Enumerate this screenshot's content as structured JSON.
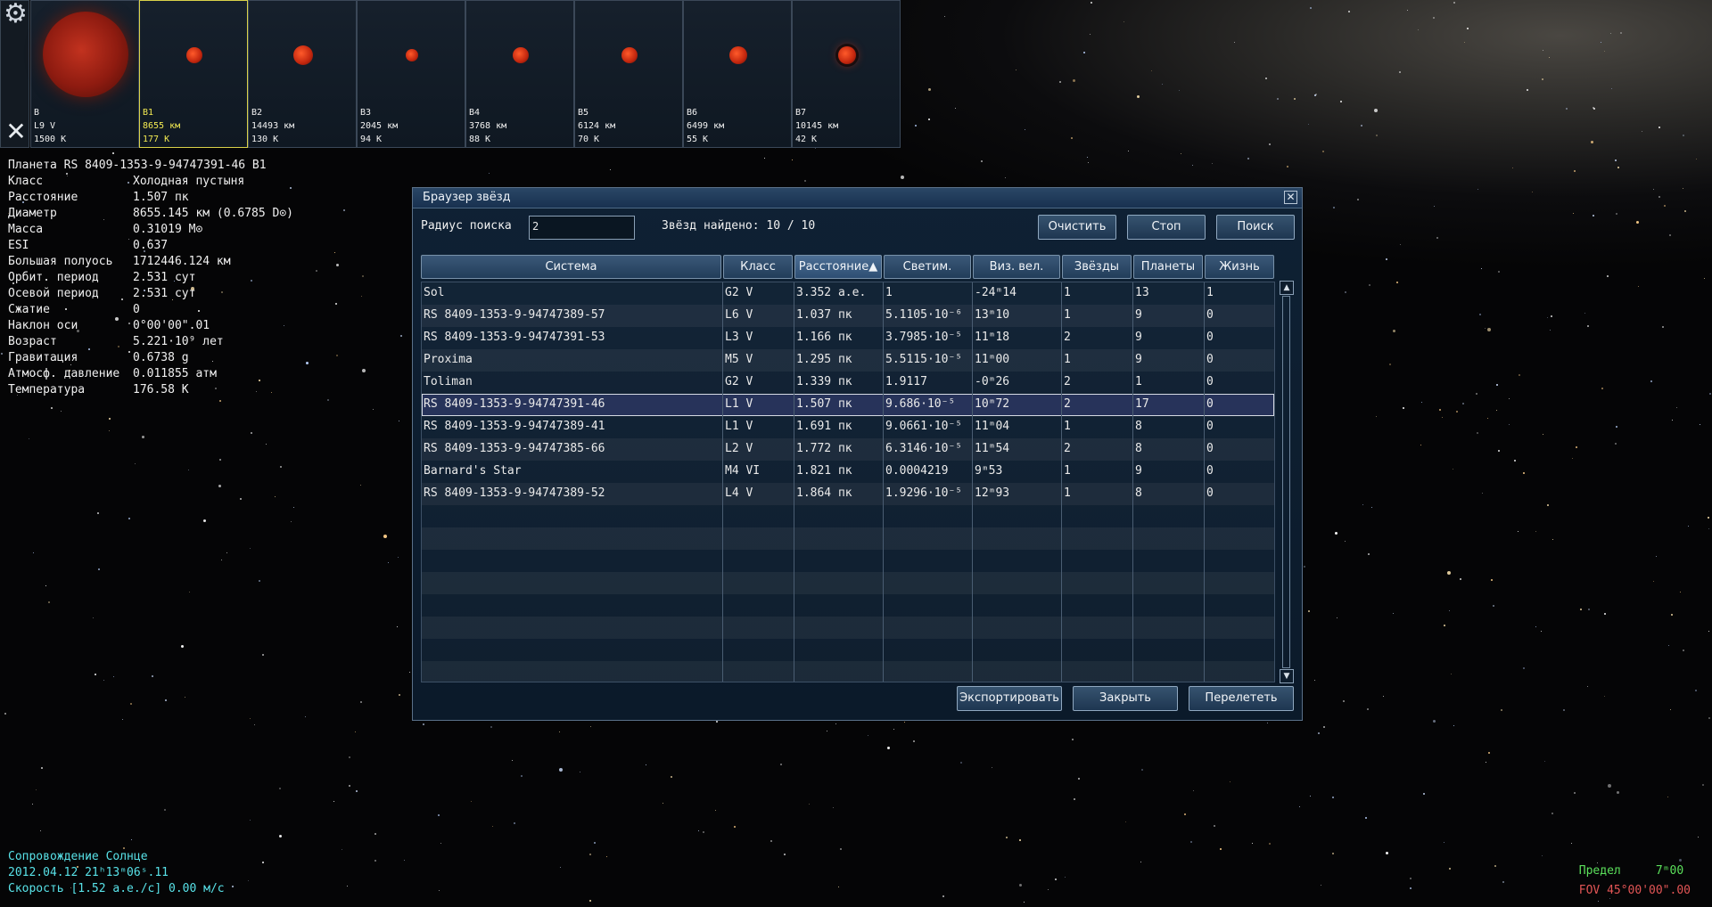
{
  "colors": {
    "accent": "#27335a",
    "status_text": "#58e2e8",
    "limit_text": "#5be05b",
    "fov_text": "#e25555",
    "selected_thumb": "#f3ea52"
  },
  "thumbnails": [
    {
      "name": "B",
      "line2": "L9 V",
      "line3": "1500 K",
      "selected": false
    },
    {
      "name": "B1",
      "line2": "8655 км",
      "line3": "177 K",
      "selected": true
    },
    {
      "name": "B2",
      "line2": "14493 км",
      "line3": "130 K",
      "selected": false
    },
    {
      "name": "B3",
      "line2": "2045 км",
      "line3": "94 K",
      "selected": false
    },
    {
      "name": "B4",
      "line2": "3768 км",
      "line3": "88 K",
      "selected": false
    },
    {
      "name": "B5",
      "line2": "6124 км",
      "line3": "70 K",
      "selected": false
    },
    {
      "name": "B6",
      "line2": "6499 км",
      "line3": "55 K",
      "selected": false
    },
    {
      "name": "B7",
      "line2": "10145 км",
      "line3": "42 K",
      "selected": false
    }
  ],
  "planet_info": {
    "title": "Планета  RS 8409-1353-9-94747391-46 B1",
    "rows": [
      {
        "label": "Класс",
        "value": "Холодная пустыня"
      },
      {
        "label": "Расстояние",
        "value": "1.507 пк"
      },
      {
        "label": "Диаметр",
        "value": "8655.145 км (0.6785 D⊙)"
      },
      {
        "label": "Масса",
        "value": "0.31019 M⊙"
      },
      {
        "label": "ESI",
        "value": "0.637"
      },
      {
        "label": "Большая полуось",
        "value": "1712446.124 км"
      },
      {
        "label": "Орбит. период",
        "value": "2.531 сут"
      },
      {
        "label": "Осевой период",
        "value": "2.531 сут"
      },
      {
        "label": "Сжатие",
        "value": "0"
      },
      {
        "label": "Наклон оси",
        "value": "0°00'00\".01"
      },
      {
        "label": "Возраст",
        "value": "5.221·10⁹ лет"
      },
      {
        "label": "Гравитация",
        "value": "0.6738 g"
      },
      {
        "label": "Атмосф. давление",
        "value": "0.011855 атм"
      },
      {
        "label": "Температура",
        "value": "176.58 K"
      }
    ]
  },
  "dialog": {
    "title": "Браузер звёзд",
    "search_label": "Радиус поиска",
    "search_value": "2",
    "found_text": "Звёзд найдено: 10 / 10",
    "buttons": {
      "clear": "Очистить",
      "stop": "Стоп",
      "search": "Поиск",
      "export": "Экспортировать",
      "close": "Закрыть",
      "goto": "Перелететь"
    },
    "columns": [
      "Система",
      "Класс",
      "Расстояние▲",
      "Светим.",
      "Виз. вел.",
      "Звёзды",
      "Планеты",
      "Жизнь"
    ],
    "selected_row": 5,
    "rows": [
      [
        "Sol",
        "G2 V",
        "3.352 а.е.",
        "1",
        "-24ᵐ14",
        "1",
        "13",
        "1"
      ],
      [
        "RS 8409-1353-9-94747389-57",
        "L6 V",
        "1.037 пк",
        "5.1105·10⁻⁶",
        "13ᵐ10",
        "1",
        "9",
        "0"
      ],
      [
        "RS 8409-1353-9-94747391-53",
        "L3 V",
        "1.166 пк",
        "3.7985·10⁻⁵",
        "11ᵐ18",
        "2",
        "9",
        "0"
      ],
      [
        "Proxima",
        "M5 V",
        "1.295 пк",
        "5.5115·10⁻⁵",
        "11ᵐ00",
        "1",
        "9",
        "0"
      ],
      [
        "Toliman",
        "G2 V",
        "1.339 пк",
        "1.9117",
        "-0ᵐ26",
        "2",
        "1",
        "0"
      ],
      [
        "RS 8409-1353-9-94747391-46",
        "L1 V",
        "1.507 пк",
        "9.686·10⁻⁵",
        "10ᵐ72",
        "2",
        "17",
        "0"
      ],
      [
        "RS 8409-1353-9-94747389-41",
        "L1 V",
        "1.691 пк",
        "9.0661·10⁻⁵",
        "11ᵐ04",
        "1",
        "8",
        "0"
      ],
      [
        "RS 8409-1353-9-94747385-66",
        "L2 V",
        "1.772 пк",
        "6.3146·10⁻⁵",
        "11ᵐ54",
        "2",
        "8",
        "0"
      ],
      [
        "Barnard's Star",
        "M4 VI",
        "1.821 пк",
        "0.0004219",
        "9ᵐ53",
        "1",
        "9",
        "0"
      ],
      [
        "RS 8409-1353-9-94747389-52",
        "L4 V",
        "1.864 пк",
        "1.9296·10⁻⁵",
        "12ᵐ93",
        "1",
        "8",
        "0"
      ]
    ],
    "empty_rows": 8
  },
  "status": {
    "line1": "Сопровождение Солнце",
    "line2": "2012.04.12 21ʰ13ᵐ06ˢ.11",
    "line3": "Скорость [1.52 а.е./с] 0.00 м/с"
  },
  "limit": {
    "line1": "Предел     7ᵐ00",
    "line2": "FOV 45°00'00\".00"
  }
}
